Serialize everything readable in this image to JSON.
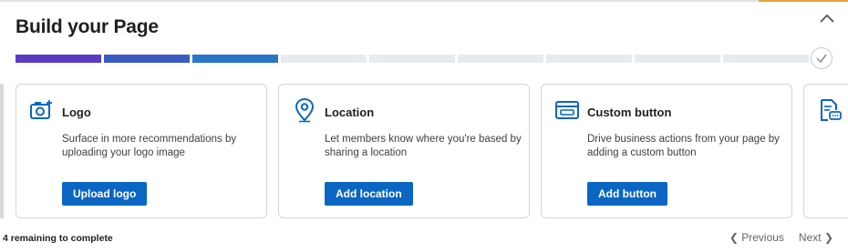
{
  "header": {
    "title": "Build your Page"
  },
  "progress": {
    "completed_steps": 3,
    "total_steps": 9
  },
  "cards": [
    {
      "title": "Logo",
      "description": "Surface in more recommendations by uploading your logo image",
      "button": "Upload logo",
      "icon": "camera-add-icon"
    },
    {
      "title": "Location",
      "description": "Let members know where you're based by sharing a location",
      "button": "Add location",
      "icon": "location-pin-icon"
    },
    {
      "title": "Custom button",
      "description": "Drive business actions from your page by adding a custom button",
      "button": "Add button",
      "icon": "custom-button-icon"
    },
    {
      "icon": "document-chat-icon"
    }
  ],
  "footer": {
    "remaining": "4 remaining to complete",
    "prev": "Previous",
    "next": "Next"
  },
  "colors": {
    "primary_button": "#0a66c2",
    "progress_1": "#5b3bbf",
    "progress_2": "#3a5bc3",
    "progress_3": "#2a75c7",
    "progress_empty": "#e6ebef"
  }
}
